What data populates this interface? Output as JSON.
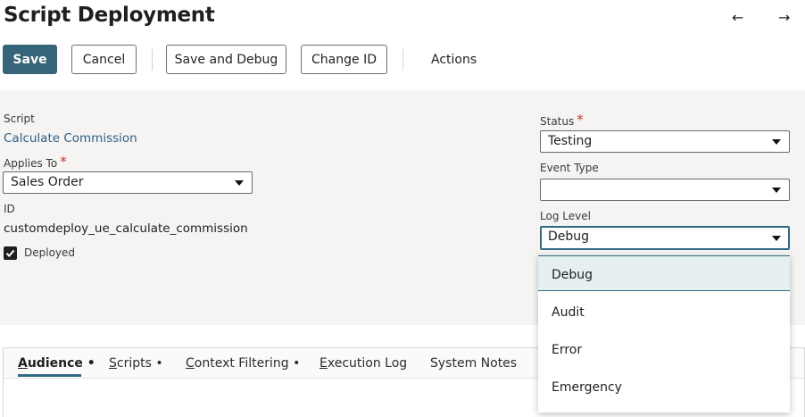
{
  "page": {
    "title": "Script Deployment"
  },
  "nav": {
    "back": "←",
    "forward": "→"
  },
  "toolbar": {
    "save": "Save",
    "cancel": "Cancel",
    "save_and_debug": "Save and Debug",
    "change_id": "Change ID",
    "actions": "Actions",
    "primary_color": "#366478"
  },
  "form": {
    "script": {
      "label": "Script",
      "value": "Calculate Commission"
    },
    "applies_to": {
      "label": "Applies To",
      "required": "*",
      "value": "Sales Order"
    },
    "id": {
      "label": "ID",
      "value": "customdeploy_ue_calculate_commission"
    },
    "deployed": {
      "label": "Deployed",
      "checked": true
    },
    "status": {
      "label": "Status",
      "required": "*",
      "value": "Testing"
    },
    "event_type": {
      "label": "Event Type",
      "value": ""
    },
    "log_level": {
      "label": "Log Level",
      "value": "Debug",
      "options": [
        "Debug",
        "Audit",
        "Error",
        "Emergency"
      ],
      "selected_index": 0
    }
  },
  "tabs": [
    {
      "prefix": "",
      "accel": "A",
      "rest": "udience",
      "dot": " •",
      "active": true
    },
    {
      "prefix": "",
      "accel": "S",
      "rest": "cripts",
      "dot": " •",
      "active": false
    },
    {
      "prefix": "",
      "accel": "C",
      "rest": "ontext Filtering",
      "dot": " •",
      "active": false
    },
    {
      "prefix": "",
      "accel": "E",
      "rest": "xecution Log",
      "dot": "",
      "active": false
    },
    {
      "prefix": "System Notes",
      "accel": "",
      "rest": "",
      "dot": "",
      "active": false
    }
  ],
  "colors": {
    "link": "#2f5f86",
    "accent": "#2e6a85",
    "required": "#c0392b",
    "panel_bg": "#f5f4f2"
  },
  "icons": {
    "back": "arrow-left-icon",
    "forward": "arrow-right-icon",
    "checkbox": "checkmark-icon",
    "dropdown": "chevron-down-icon"
  }
}
